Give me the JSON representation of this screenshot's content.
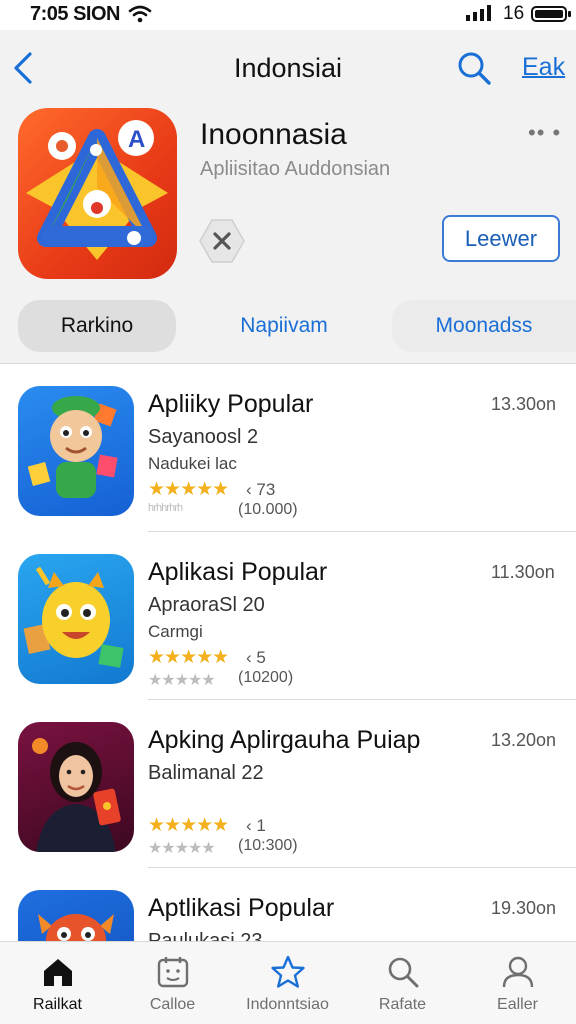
{
  "status_bar": {
    "time": "7:05 SION",
    "battery_level": "16"
  },
  "nav": {
    "title": "Indonsiai",
    "link_label": "Eak"
  },
  "app": {
    "name": "Inoonnasia",
    "subtitle": "Apliisitao Auddonsian",
    "more": "•• •",
    "get_label": "Leewer"
  },
  "segments": [
    "Rarkino",
    "Napiivam",
    "Moonadss"
  ],
  "list": [
    {
      "title": "Apliiky Popular",
      "subtitle": "Sayanoosl 2",
      "category": "Nadukei lac",
      "size": "13.30on",
      "stars": "★★★★★",
      "rating": "‹ 73",
      "ghost": "ʰʳʰʰʳʰʳʰ",
      "reviews": "(10.000)"
    },
    {
      "title": "Aplikasi Popular",
      "subtitle": "ApraoraSl 20",
      "category": "Carmgi",
      "size": "11.30on",
      "stars": "★★★★★",
      "rating": "‹ 5",
      "ghost": "★★★★★",
      "reviews": "(10200)"
    },
    {
      "title": "Apking Aplirgauha Puiap",
      "subtitle": "Balimanal 22",
      "category": "",
      "size": "13.20on",
      "stars": "★★★★★",
      "rating": "‹ 1",
      "ghost": "★★★★★",
      "reviews": "(10:300)"
    },
    {
      "title": "Aptlikasi Popular",
      "subtitle": "Paulukasi 23",
      "category": "",
      "size": "19.30on",
      "stars": "",
      "rating": "",
      "ghost": "",
      "reviews": ""
    }
  ],
  "tab_bar": [
    {
      "label": "Railkat",
      "icon": "home-icon"
    },
    {
      "label": "Calloe",
      "icon": "calendar-face-icon"
    },
    {
      "label": "Indonntsiao",
      "icon": "star-icon"
    },
    {
      "label": "Rafate",
      "icon": "search-icon"
    },
    {
      "label": "Ealler",
      "icon": "person-icon"
    }
  ],
  "colors": {
    "accent": "#1a6fd6",
    "star": "#f2b01e",
    "header_bg": "#f2f2f3"
  }
}
